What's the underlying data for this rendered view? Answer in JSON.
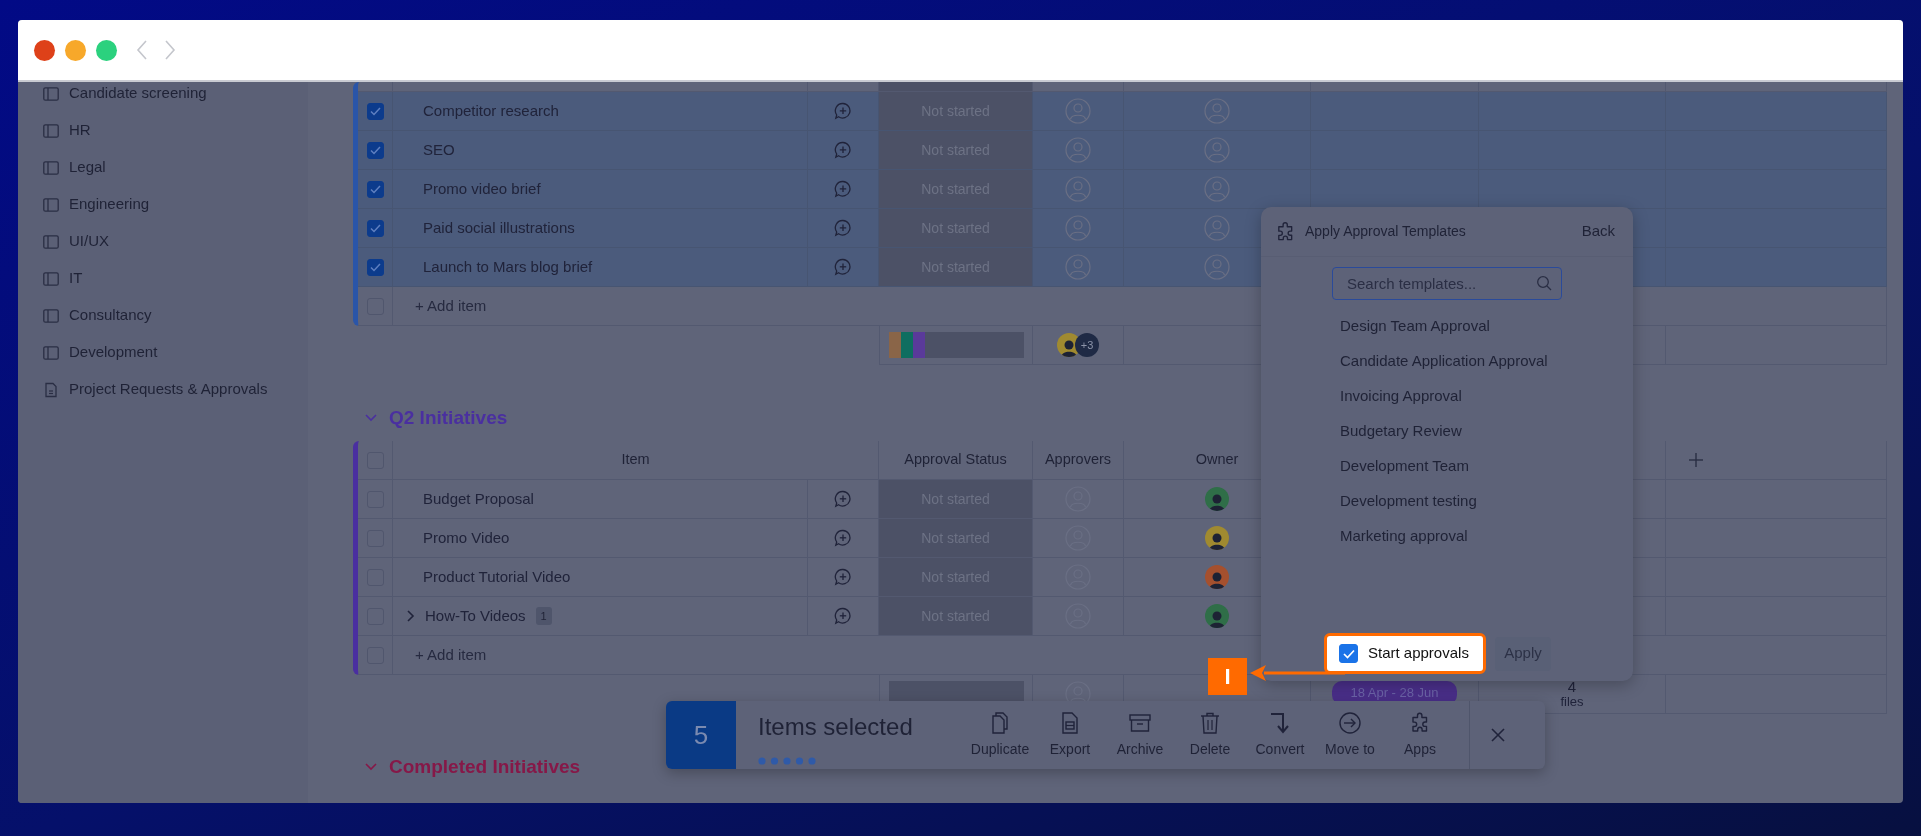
{
  "sidebar": {
    "items": [
      {
        "label": "Candidate screening",
        "kind": "board"
      },
      {
        "label": "HR",
        "kind": "board"
      },
      {
        "label": "Legal",
        "kind": "board"
      },
      {
        "label": "Engineering",
        "kind": "board"
      },
      {
        "label": "UI/UX",
        "kind": "board"
      },
      {
        "label": "IT",
        "kind": "board"
      },
      {
        "label": "Consultancy",
        "kind": "board"
      },
      {
        "label": "Development",
        "kind": "board"
      },
      {
        "label": "Project Requests & Approvals",
        "kind": "doc"
      }
    ]
  },
  "groups": [
    {
      "color": "#2a55a8",
      "add_item_checked": false,
      "rows": [
        {
          "item": "Competitor research",
          "selected": true,
          "status": "Not started"
        },
        {
          "item": "SEO",
          "selected": true,
          "status": "Not started"
        },
        {
          "item": "Promo video brief",
          "selected": true,
          "status": "Not started"
        },
        {
          "item": "Paid social illustrations",
          "selected": true,
          "status": "Not started"
        },
        {
          "item": "Launch to Mars blog brief",
          "selected": true,
          "status": "Not started"
        }
      ],
      "add_item": "+ Add item",
      "summary": {
        "status_segments": [
          {
            "color": "#8a6548"
          },
          {
            "color": "#0f6e60"
          },
          {
            "color": "#5a3a9a"
          }
        ],
        "approvers": [
          {
            "color": "#a08a30"
          }
        ],
        "approvers_more": "+3"
      }
    },
    {
      "title": "Q2 Initiatives",
      "color": "#4a2fa0",
      "select_all_checked": false,
      "add_item_checked": false,
      "columns": [
        "Item",
        "Approval Status",
        "Approvers",
        "Owner"
      ],
      "rows": [
        {
          "item": "Budget Proposal",
          "selected": false,
          "status": "Not started",
          "owner": {
            "color": "#2f6e48"
          }
        },
        {
          "item": "Promo Video",
          "selected": false,
          "status": "Not started",
          "owner": {
            "color": "#a08a30"
          }
        },
        {
          "item": "Product Tutorial Video",
          "selected": false,
          "status": "Not started",
          "owner": {
            "color": "#a5502e"
          }
        },
        {
          "item": "How-To Videos",
          "selected": false,
          "status": "Not started",
          "expanded": false,
          "subitem_count": "1",
          "owner": {
            "color": "#2f6e48"
          }
        }
      ],
      "add_item": "+ Add item",
      "summary": {
        "timeline": "18 Apr - 28 Jun",
        "files_count": "4",
        "files_label": "files"
      }
    },
    {
      "title": "Completed Initiatives",
      "color": "#861848"
    }
  ],
  "popup": {
    "title": "Apply Approval Templates",
    "back": "Back",
    "search_placeholder": "Search templates...",
    "templates": [
      "Design Team Approval",
      "Candidate Application Approval",
      "Invoicing Approval",
      "Budgetary Review",
      "Development Team",
      "Development testing",
      "Marketing approval"
    ],
    "start_approvals": {
      "label": "Start approvals",
      "checked": true
    },
    "apply": {
      "label": "Apply",
      "disabled": true
    }
  },
  "step_marker": {
    "label": "I"
  },
  "selection_bar": {
    "count": "5",
    "label": "Items selected",
    "actions": [
      {
        "label": "Duplicate",
        "kind": "duplicate"
      },
      {
        "label": "Export",
        "kind": "export"
      },
      {
        "label": "Archive",
        "kind": "archive"
      },
      {
        "label": "Delete",
        "kind": "delete"
      },
      {
        "label": "Convert",
        "kind": "convert"
      },
      {
        "label": "Move to",
        "kind": "move"
      },
      {
        "label": "Apps",
        "kind": "apps"
      }
    ]
  }
}
